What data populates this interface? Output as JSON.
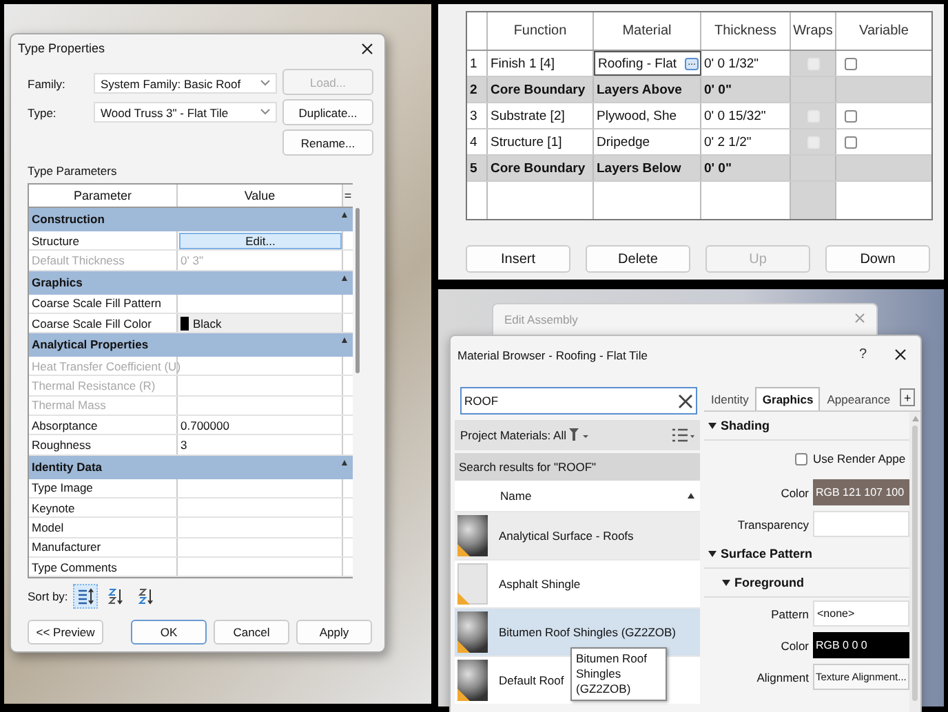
{
  "type_properties": {
    "title": "Type Properties",
    "fields": [
      {
        "label": "Family:",
        "value": "System Family: Basic Roof"
      },
      {
        "label": "Type:",
        "value": "Wood Truss 3\" - Flat Tile"
      }
    ],
    "side_buttons": [
      {
        "label": "Load...",
        "disabled": true
      },
      {
        "label": "Duplicate...",
        "disabled": false
      },
      {
        "label": "Rename...",
        "disabled": false
      }
    ],
    "section_label": "Type Parameters",
    "columns": [
      "Parameter",
      "Value",
      "="
    ],
    "groups": [
      {
        "name": "Construction",
        "rows": [
          {
            "kind": "button",
            "parameter": "Structure",
            "value": "Edit...",
            "disabled": false
          },
          {
            "kind": "text",
            "parameter": "Default Thickness",
            "value": "0'  3\"",
            "disabled": true
          }
        ]
      },
      {
        "name": "Graphics",
        "rows": [
          {
            "kind": "text",
            "parameter": "Coarse Scale Fill Pattern",
            "disabled": false
          },
          {
            "kind": "color",
            "parameter": "Coarse Scale Fill Color",
            "value": "Black",
            "color": "#000000",
            "disabled": false
          }
        ]
      },
      {
        "name": "Analytical Properties",
        "rows": [
          {
            "kind": "text",
            "parameter": "Heat Transfer Coefficient (U)",
            "disabled": true
          },
          {
            "kind": "text",
            "parameter": "Thermal Resistance (R)",
            "disabled": true
          },
          {
            "kind": "text",
            "parameter": "Thermal Mass",
            "disabled": true
          },
          {
            "kind": "text",
            "parameter": "Absorptance",
            "value": "0.700000",
            "disabled": false
          },
          {
            "kind": "text",
            "parameter": "Roughness",
            "value": "3",
            "disabled": false
          }
        ]
      },
      {
        "name": "Identity Data",
        "rows": [
          {
            "kind": "text",
            "parameter": "Type Image",
            "disabled": false
          },
          {
            "kind": "text",
            "parameter": "Keynote",
            "disabled": false
          },
          {
            "kind": "text",
            "parameter": "Model",
            "disabled": false
          },
          {
            "kind": "text",
            "parameter": "Manufacturer",
            "disabled": false
          },
          {
            "kind": "text",
            "parameter": "Type Comments",
            "disabled": false
          }
        ]
      }
    ],
    "sort_label": "Sort by:",
    "sort_options": [
      {
        "kind": "group",
        "selected": true
      },
      {
        "kind": "ascending",
        "selected": false
      },
      {
        "kind": "descending",
        "selected": false
      }
    ],
    "buttons": [
      {
        "label": "<< Preview",
        "default": false
      },
      {
        "label": "OK",
        "default": true
      },
      {
        "label": "Cancel",
        "default": false
      },
      {
        "label": "Apply",
        "default": false
      }
    ]
  },
  "layers": {
    "columns": [
      "Function",
      "Material",
      "Thickness",
      "Wraps",
      "Variable"
    ],
    "rows": [
      {
        "number": "1",
        "kind": "layer",
        "function": "Finish 1 [4]",
        "material": "Roofing - Flat",
        "thickness": "0'  0 1/32\"",
        "wraps": false,
        "variable": false,
        "editing": true
      },
      {
        "number": "2",
        "kind": "boundary",
        "function": "Core Boundary",
        "material": "Layers Above",
        "thickness": "0'  0\""
      },
      {
        "number": "3",
        "kind": "layer",
        "function": "Substrate [2]",
        "material": "Plywood, She",
        "thickness": "0'  0 15/32\"",
        "wraps": false,
        "variable": false,
        "editing": false
      },
      {
        "number": "4",
        "kind": "layer",
        "function": "Structure [1]",
        "material": "Dripedge",
        "thickness": "0'  2 1/2\"",
        "wraps": false,
        "variable": false,
        "editing": false
      },
      {
        "number": "5",
        "kind": "boundary",
        "function": "Core Boundary",
        "material": "Layers Below",
        "thickness": "0'  0\""
      }
    ],
    "browse_button": "...",
    "buttons": [
      {
        "label": "Insert",
        "disabled": false
      },
      {
        "label": "Delete",
        "disabled": false
      },
      {
        "label": "Up",
        "disabled": true
      },
      {
        "label": "Down",
        "disabled": false
      }
    ]
  },
  "edit_assembly": {
    "title": "Edit Assembly"
  },
  "material_browser": {
    "title": "Material Browser - Roofing - Flat Tile",
    "help": "?",
    "search": {
      "value": "ROOF"
    },
    "filter": "Project Materials: All",
    "results_heading": "Search results for \"ROOF\"",
    "list_column": "Name",
    "materials": [
      {
        "name": "Analytical Surface - Roofs",
        "kind": "sphere",
        "selected": false
      },
      {
        "name": "Asphalt Shingle",
        "kind": "tile",
        "selected": false
      },
      {
        "name": "Bitumen Roof Shingles (GZ2ZOB)",
        "kind": "sphere",
        "selected": true
      },
      {
        "name": "Default Roof",
        "kind": "sphere",
        "selected": false
      }
    ],
    "tooltip": "Bitumen Roof Shingles (GZ2ZOB)",
    "tabs": [
      {
        "label": "Identity",
        "selected": false
      },
      {
        "label": "Graphics",
        "selected": true
      },
      {
        "label": "Appearance",
        "selected": false
      }
    ],
    "add_tab": "+",
    "properties": [
      {
        "kind": "heading",
        "label": "Shading",
        "expanded": true
      },
      {
        "kind": "checkbox",
        "label": "Use Render Appe",
        "checked": false
      },
      {
        "kind": "swatch",
        "label": "Color",
        "value": "RGB 121 107 100",
        "color": "#796b64"
      },
      {
        "kind": "input",
        "label": "Transparency"
      },
      {
        "kind": "heading",
        "label": "Surface Pattern",
        "expanded": true
      },
      {
        "kind": "subheading",
        "label": "Foreground",
        "expanded": true
      },
      {
        "kind": "input",
        "label": "Pattern",
        "value": "<none>"
      },
      {
        "kind": "swatch",
        "label": "Color",
        "value": "RGB 0 0 0",
        "color": "#000000"
      },
      {
        "kind": "button",
        "label": "Alignment",
        "value": "Texture Alignment..."
      }
    ]
  }
}
